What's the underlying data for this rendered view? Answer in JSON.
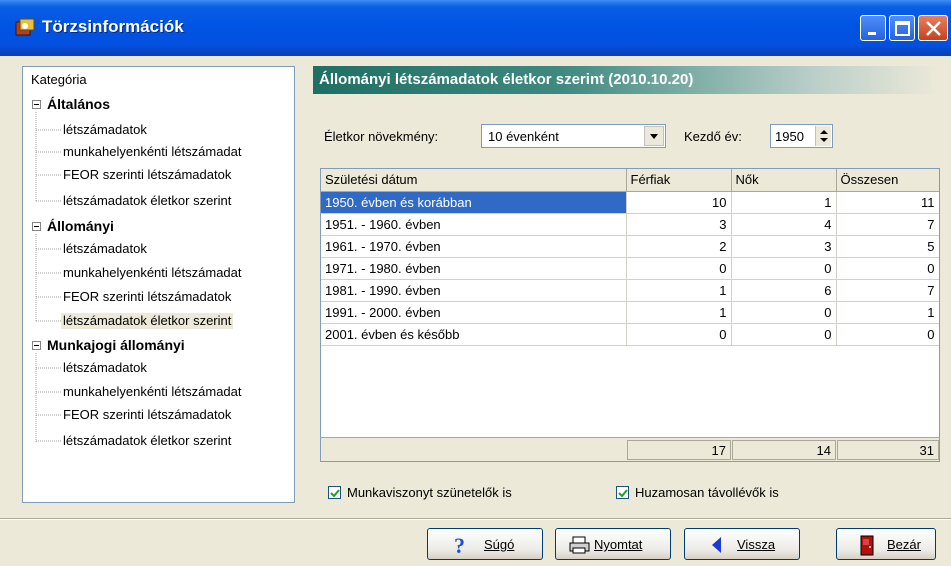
{
  "window": {
    "title": "Törzsinformációk"
  },
  "tree": {
    "header": "Kategória",
    "groups": [
      {
        "label": "Általános",
        "items": [
          "létszámadatok",
          "munkahelyenkénti létszámadat",
          "FEOR szerinti létszámadatok",
          "létszámadatok életkor szerint"
        ]
      },
      {
        "label": "Állományi",
        "items": [
          "létszámadatok",
          "munkahelyenkénti létszámadat",
          "FEOR szerinti létszámadatok",
          "létszámadatok életkor szerint"
        ]
      },
      {
        "label": "Munkajogi állományi",
        "items": [
          "létszámadatok",
          "munkahelyenkénti létszámadat",
          "FEOR szerinti létszámadatok",
          "létszámadatok életkor szerint"
        ]
      }
    ],
    "selected": "Állományi / létszámadatok életkor szerint"
  },
  "section": {
    "title": "Állományi létszámadatok életkor szerint (2010.10.20)"
  },
  "filters": {
    "increment_label": "Életkor növekmény:",
    "increment_value": "10 évenként",
    "start_year_label": "Kezdő év:",
    "start_year_value": "1950"
  },
  "grid": {
    "columns": [
      "Születési dátum",
      "Férfiak",
      "Nők",
      "Összesen"
    ],
    "rows": [
      [
        "1950. évben és korábban",
        "10",
        "1",
        "11"
      ],
      [
        "1951. - 1960. évben",
        "3",
        "4",
        "7"
      ],
      [
        "1961. - 1970. évben",
        "2",
        "3",
        "5"
      ],
      [
        "1971. - 1980. évben",
        "0",
        "0",
        "0"
      ],
      [
        "1981. - 1990. évben",
        "1",
        "6",
        "7"
      ],
      [
        "1991. - 2000. évben",
        "1",
        "0",
        "1"
      ],
      [
        "2001. évben és később",
        "0",
        "0",
        "0"
      ]
    ],
    "totals": [
      "17",
      "14",
      "31"
    ]
  },
  "options": {
    "suspended_label": "Munkaviszonyt szünetelők is",
    "suspended_checked": true,
    "absent_label": "Huzamosan távollévők is",
    "absent_checked": true
  },
  "buttons": {
    "help": "Súgó",
    "print": "Nyomtat",
    "back": "Vissza",
    "close": "Bezár"
  },
  "colors": {
    "titlebar": "#0054e3",
    "section_header": "#1e6f64",
    "selection": "#316ac5"
  }
}
